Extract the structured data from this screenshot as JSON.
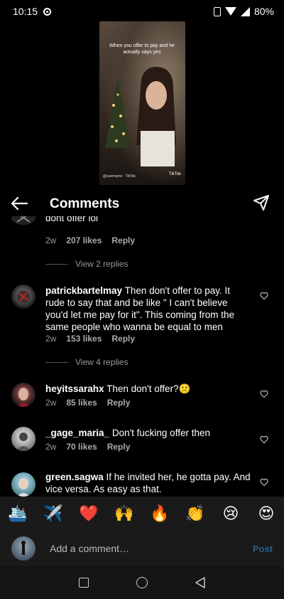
{
  "status_bar": {
    "time": "10:15",
    "battery": "80%"
  },
  "video": {
    "caption": "When you offer to pay and he actually says yes",
    "watermark": "TikTok",
    "bottom_text": "@username · TikTok"
  },
  "header": {
    "title": "Comments"
  },
  "comments": [
    {
      "username": "",
      "text": "dont offer lol",
      "age": "2w",
      "likes": "207 likes",
      "reply": "Reply",
      "view_replies": "View 2 replies"
    },
    {
      "username": "patrickbartelmay",
      "text": " Then don't offer to pay. It rude to say that and be like \" I can't believe you'd let me pay for it\". This coming from the same people who wanna be equal to men",
      "age": "2w",
      "likes": "153 likes",
      "reply": "Reply",
      "view_replies": "View 4 replies"
    },
    {
      "username": "heyitssarahx",
      "text": " Then don't offer?🙁",
      "age": "2w",
      "likes": "85 likes",
      "reply": "Reply"
    },
    {
      "username": "_gage_maria_",
      "text": " Don't fucking offer then",
      "age": "2w",
      "likes": "70 likes",
      "reply": "Reply"
    },
    {
      "username": "green.sagwa",
      "text": " If he invited her, he gotta pay. And vice versa. As easy as that."
    }
  ],
  "emoji_bar": [
    "🛳️",
    "✈️",
    "❤️",
    "🙌",
    "🔥",
    "👏",
    "😢",
    "😍"
  ],
  "comment_input": {
    "placeholder": "Add a comment…",
    "post_label": "Post"
  },
  "colors": {
    "background": "#000000",
    "meta_text": "#999999",
    "post_link": "#2a5d8c"
  }
}
